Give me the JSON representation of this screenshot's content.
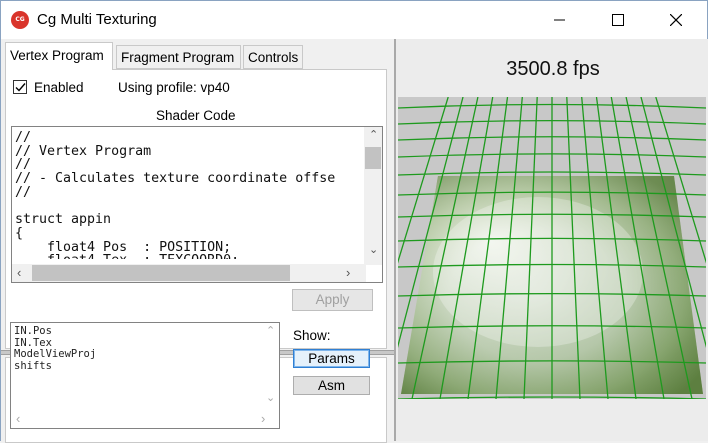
{
  "window": {
    "icon_text": "CG",
    "title": "Cg Multi Texturing"
  },
  "tabs": [
    {
      "label": "Vertex Program",
      "active": true
    },
    {
      "label": "Fragment Program",
      "active": false
    },
    {
      "label": "Controls",
      "active": false
    }
  ],
  "vertex_panel": {
    "enabled_label": "Enabled",
    "enabled_checked": true,
    "profile_text": "Using profile: vp40",
    "shader_code_label": "Shader Code",
    "code": "//\n// Vertex Program\n//\n// - Calculates texture coordinate offse\n//\n\nstruct appin\n{\n    float4 Pos  : POSITION;\n    float4 Tex  : TEXCOORD0;",
    "apply_label": "Apply"
  },
  "params_list": {
    "items": "IN.Pos\nIN.Tex\nModelViewProj\nshifts"
  },
  "show": {
    "label": "Show:",
    "params_label": "Params",
    "asm_label": "Asm"
  },
  "render": {
    "fps_text": "3500.8 fps"
  },
  "colors": {
    "grid": "#1e9a1e",
    "accent": "#2f7fd3",
    "close_red": "#d9342b"
  }
}
